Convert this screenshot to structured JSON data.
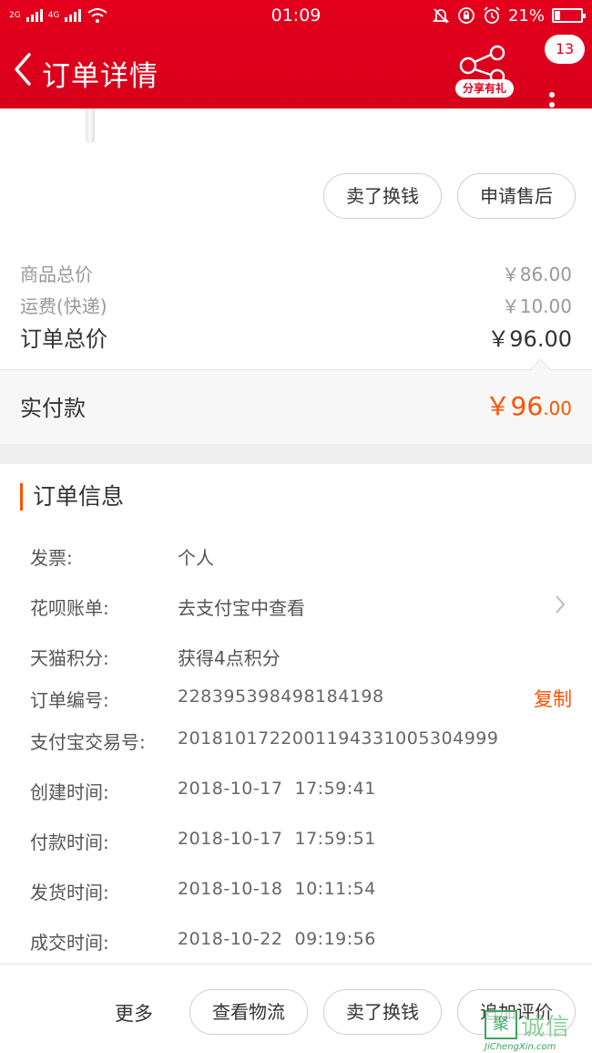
{
  "status_bar": {
    "network_1": "2G",
    "network_2": "4G",
    "time": "01:09",
    "battery": "21%",
    "battery_level": 0.21
  },
  "header": {
    "title": "订单详情",
    "share_label": "分享有礼",
    "message_count": "13"
  },
  "actions": {
    "sell_label": "卖了换钱",
    "after_sale_label": "申请售后"
  },
  "price_summary": {
    "goods_total_label": "商品总价",
    "goods_total_value": "￥86.00",
    "shipping_label": "运费(快递)",
    "shipping_value": "￥10.00",
    "order_total_label": "订单总价",
    "order_total_value": "￥96.00",
    "paid_label": "实付款",
    "paid_main": "￥96",
    "paid_decimal": ".00"
  },
  "order_info": {
    "title": "订单信息",
    "rows": [
      {
        "label": "发票:",
        "value": "个人"
      },
      {
        "label": "花呗账单:",
        "value": "去支付宝中查看"
      },
      {
        "label": "天猫积分:",
        "value": "获得4点积分"
      },
      {
        "label": "订单编号:",
        "value": "228395398498184198"
      },
      {
        "label": "支付宝交易号:",
        "value": "2018101722001194331005304999"
      },
      {
        "label": "创建时间:",
        "value": "2018-10-17  17:59:41"
      },
      {
        "label": "付款时间:",
        "value": "2018-10-17  17:59:51"
      },
      {
        "label": "发货时间:",
        "value": "2018-10-18  10:11:54"
      },
      {
        "label": "成交时间:",
        "value": "2018-10-22  09:19:56"
      }
    ],
    "copy_label": "复制"
  },
  "bottom_bar": {
    "more_label": "更多",
    "logistics_label": "查看物流",
    "sell_label": "卖了换钱",
    "review_label": "追加评价"
  },
  "watermark": {
    "text": "诚信",
    "box_char": "聚",
    "url": "JiChengXin.com"
  },
  "colors": {
    "header_red": "#e4001d",
    "accent_orange": "#ff5000"
  }
}
